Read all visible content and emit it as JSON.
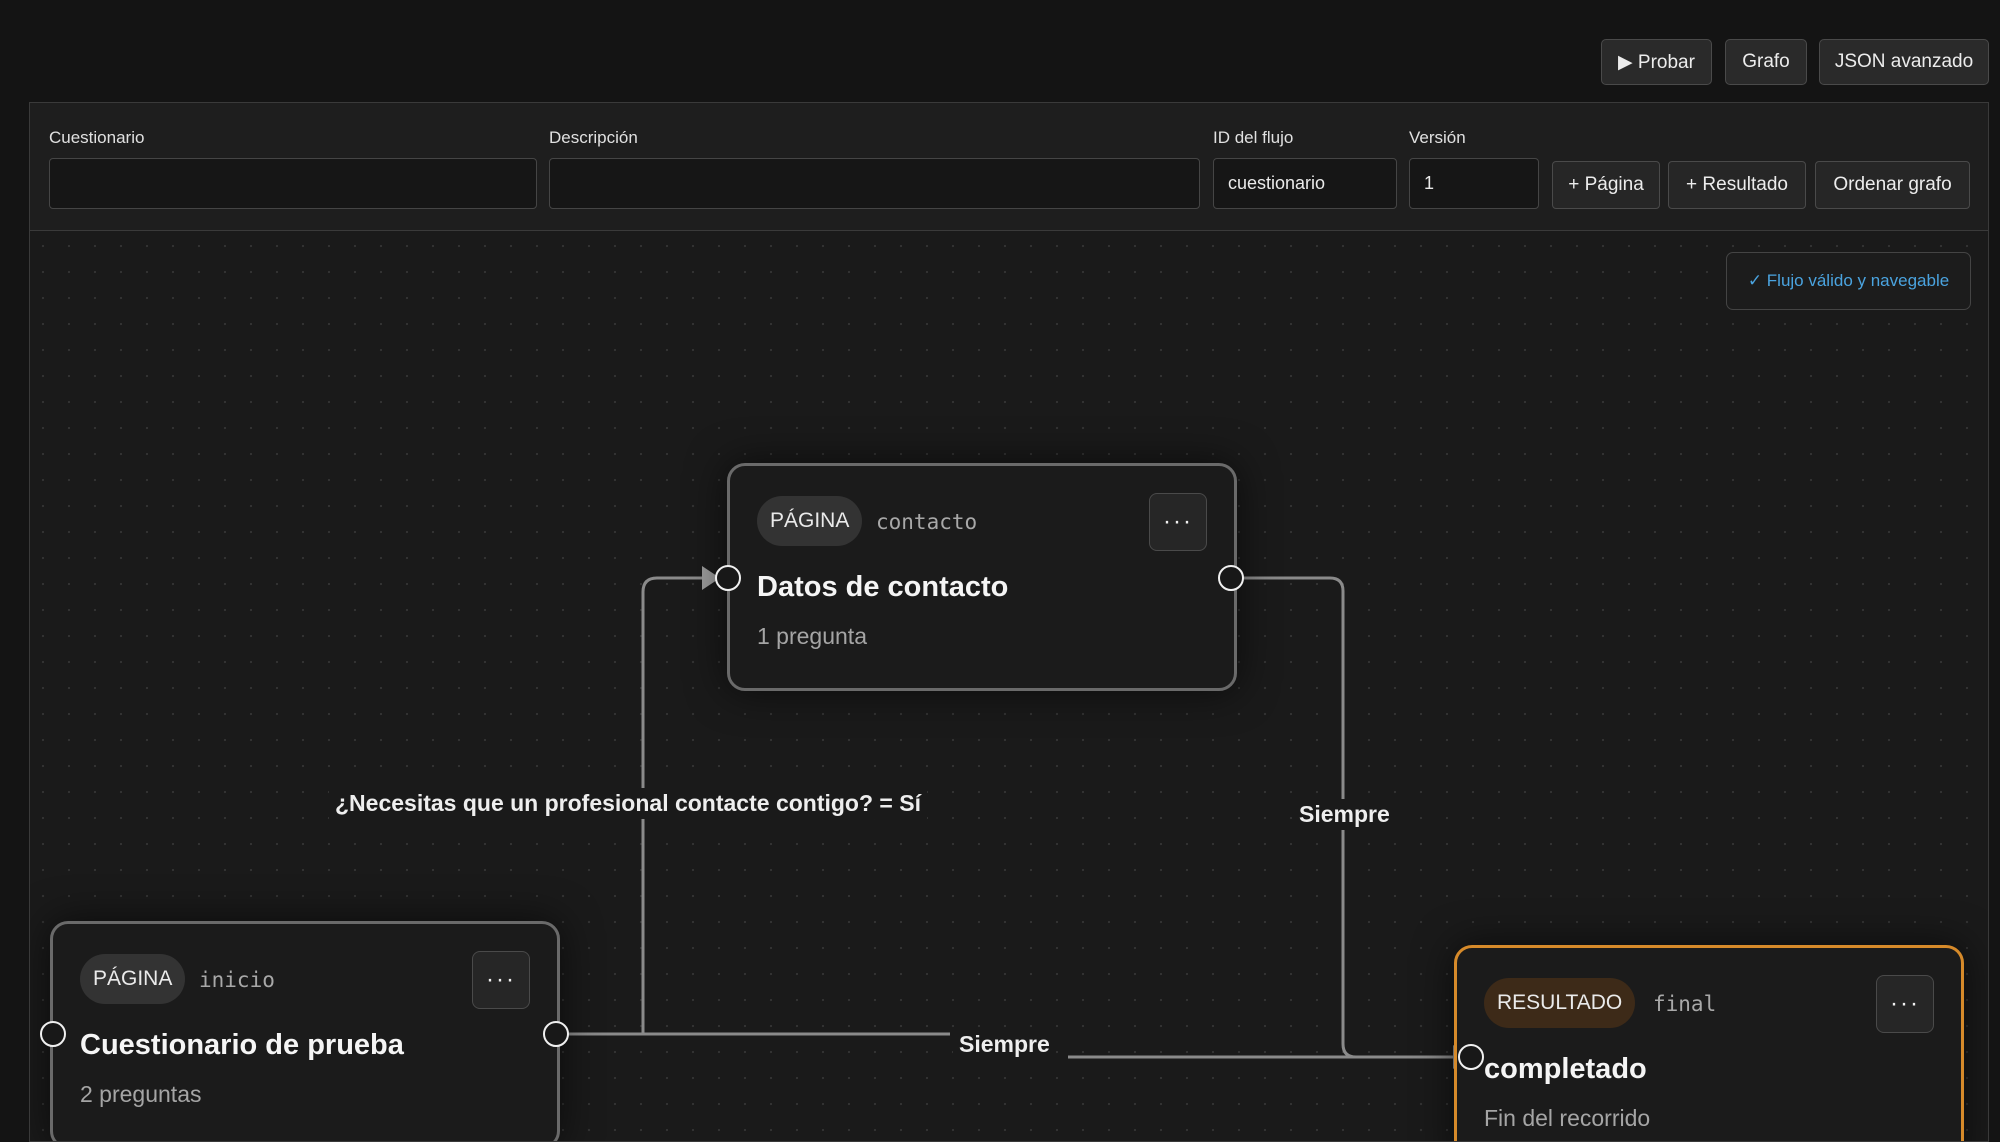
{
  "top_actions": {
    "probar": "▶ Probar",
    "grafo": "Grafo",
    "json": "JSON avanzado"
  },
  "toolbar": {
    "cuestionario_label": "Cuestionario",
    "cuestionario_value": "",
    "descripcion_label": "Descripción",
    "descripcion_value": "",
    "id_label": "ID del flujo",
    "id_value": "cuestionario",
    "version_label": "Versión",
    "version_value": "1",
    "add_page": "+ Página",
    "add_result": "+ Resultado",
    "sort_graph": "Ordenar grafo"
  },
  "status": "✓ Flujo válido y navegable",
  "nodes": {
    "contacto": {
      "type": "PÁGINA",
      "id": "contacto",
      "title": "Datos de contacto",
      "subtitle": "1 pregunta",
      "menu": "···"
    },
    "inicio": {
      "type": "PÁGINA",
      "id": "inicio",
      "title": "Cuestionario de prueba",
      "subtitle": "2 preguntas",
      "menu": "···"
    },
    "final": {
      "type": "RESULTADO",
      "id": "final",
      "title": "completado",
      "subtitle": "Fin del recorrido",
      "menu": "···"
    }
  },
  "edges": {
    "inicio_contacto": "¿Necesitas que un profesional contacte contigo? = Sí",
    "contacto_final": "Siempre",
    "inicio_final": "Siempre"
  },
  "colors": {
    "accent_result": "#d68a2a",
    "status_text": "#4aa3df"
  }
}
